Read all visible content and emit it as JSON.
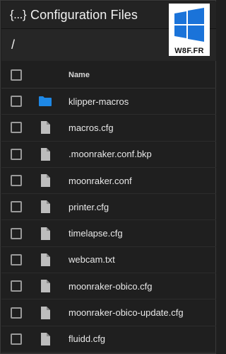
{
  "header": {
    "icon_text": "{...}",
    "title": "Configuration Files"
  },
  "path": "/",
  "watermark": {
    "text": "W8F.FR",
    "accent": "#1a73d9"
  },
  "table": {
    "column_name": "Name",
    "rows": [
      {
        "name": "klipper-macros",
        "icon": "folder-icon"
      },
      {
        "name": "macros.cfg",
        "icon": "file-icon"
      },
      {
        "name": ".moonraker.conf.bkp",
        "icon": "file-icon"
      },
      {
        "name": "moonraker.conf",
        "icon": "file-icon"
      },
      {
        "name": "printer.cfg",
        "icon": "file-icon"
      },
      {
        "name": "timelapse.cfg",
        "icon": "file-icon"
      },
      {
        "name": "webcam.txt",
        "icon": "file-icon"
      },
      {
        "name": "moonraker-obico.cfg",
        "icon": "file-icon"
      },
      {
        "name": "moonraker-obico-update.cfg",
        "icon": "file-icon"
      },
      {
        "name": "fluidd.cfg",
        "icon": "file-icon"
      }
    ]
  },
  "colors": {
    "folder": "#1e88e5",
    "file": "#bdbdbd",
    "background": "#1f1f1f"
  }
}
